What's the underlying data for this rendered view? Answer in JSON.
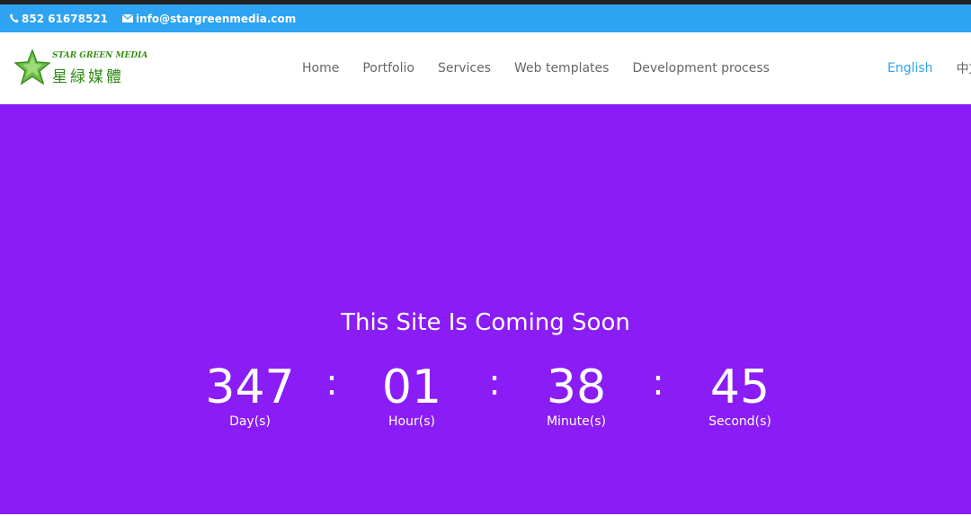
{
  "topbar": {
    "phone": "852 61678521",
    "email": "info@stargreenmedia.com",
    "phone_icon": "phone-icon",
    "email_icon": "envelope-icon",
    "bg_color": "#2ea3f2"
  },
  "logo": {
    "top_text": "STAR GREEN MEDIA",
    "bottom_text": "星緑媒體",
    "icon": "green-star-icon"
  },
  "nav": {
    "items": [
      {
        "label": "Home"
      },
      {
        "label": "Portfolio"
      },
      {
        "label": "Services"
      },
      {
        "label": "Web templates"
      },
      {
        "label": "Development process"
      }
    ]
  },
  "lang": {
    "english": "English",
    "chinese": "中文"
  },
  "hero": {
    "bg_color": "#8a1cf5",
    "title": "This Site Is Coming Soon",
    "countdown": [
      {
        "value": "347",
        "label": "Day(s)"
      },
      {
        "value": "01",
        "label": "Hour(s)"
      },
      {
        "value": "38",
        "label": "Minute(s)"
      },
      {
        "value": "45",
        "label": "Second(s)"
      }
    ],
    "separator": ":"
  }
}
